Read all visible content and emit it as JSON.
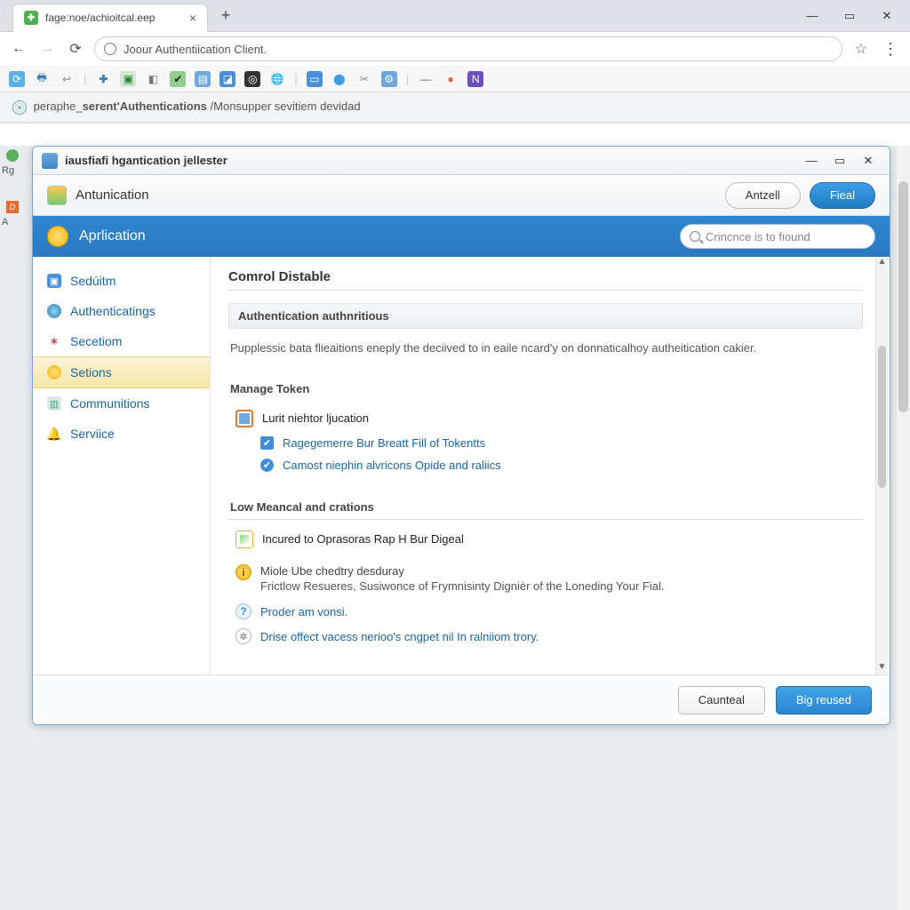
{
  "browser": {
    "tab_title": "fage:noe/achioitcal.eep",
    "omnibox": "Joour Authentiication Client.",
    "breadcrumb_prefix": "peraphe_",
    "breadcrumb_bold": "serent'Authentications",
    "breadcrumb_suffix": " /Monsupper sevitiem devidad"
  },
  "leftmini": [
    "Rg",
    "D",
    "A"
  ],
  "dialog": {
    "title": "iausfiafi hgantication jellester",
    "subheader_label": "Antunication",
    "subheader_btn_secondary": "Antzell",
    "subheader_btn_primary": "Fieal",
    "bluebar_title": "Aprlication",
    "search_placeholder": "Crincnce is to fiound"
  },
  "sidebar": {
    "items": [
      {
        "label": "Sedúitm"
      },
      {
        "label": "Authenticatings"
      },
      {
        "label": "Secetiom"
      },
      {
        "label": "Setions"
      },
      {
        "label": "Communitions"
      },
      {
        "label": "Serviice"
      }
    ]
  },
  "content": {
    "heading": "Comrol Distable",
    "section1_title": "Authentication authnritious",
    "section1_desc": "Pupplessic bata flieaitions eneply the deciived to in eaile ncard'y on donnaticalhoy autheitication cakier.",
    "section2_title": "Manage  Token",
    "opt1": "Lurit niehtor ljucation",
    "opt2": "Ragegemerre Bur Breatt Fill of Tokentts",
    "opt3": "Camost niephin alvricons Opide and raliics",
    "section3_title": "Low Meancal and crations",
    "opt4": "Incured to Oprasoras Rap H Bur Digeal",
    "warn_title": "Miole Ube chedtry desduray",
    "warn_body": "Frictlow Resueres, Susiwonce of Frymnisinty Dignièr of the Loneding Your Fial.",
    "help_link": "Proder am vonsi.",
    "gear_link": "Drise offect vacess nerioo's cngpet nil In ralniiom trory."
  },
  "footer": {
    "cancel": "Caunteal",
    "apply": "Big reused"
  }
}
